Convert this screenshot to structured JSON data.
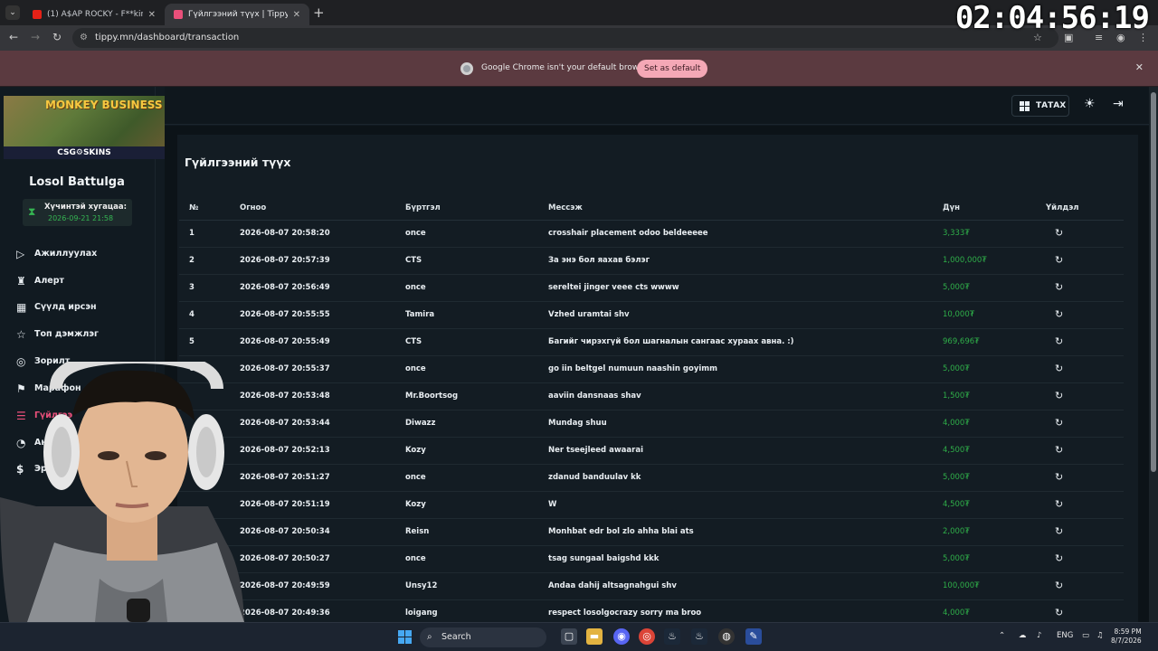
{
  "browser": {
    "tabs": [
      {
        "title": "(1) A$AP ROCKY - F**kin' Probl...",
        "active": false
      },
      {
        "title": "Гүйлгээний түүх | Tippy.mn",
        "active": true
      }
    ],
    "url": "tippy.mn/dashboard/transaction",
    "infobar_text": "Google Chrome isn't your default browser",
    "infobar_button": "Set as default"
  },
  "overlay_clock": "02:04:56:19",
  "header": {
    "download_label": "ТАТАХ"
  },
  "sidebar": {
    "banner_title": "MONKEY BUSINESS",
    "banner_brand": "CSG⚙SKINS",
    "username": "Losol Battulga",
    "subscription_label": "Хүчинтэй хугацаа:",
    "subscription_date": "2026-09-21 21:58",
    "items": [
      {
        "label": "Ажиллуулах",
        "icon": "▷"
      },
      {
        "label": "Алерт",
        "icon": "♜"
      },
      {
        "label": "Сүүлд ирсэн",
        "icon": "▦"
      },
      {
        "label": "Топ дэмжлэг",
        "icon": "☆"
      },
      {
        "label": "Зорилт",
        "icon": "◎"
      },
      {
        "label": "Марафон",
        "icon": "⚑"
      },
      {
        "label": "Гүйлгээ",
        "icon": "☰",
        "active": true
      },
      {
        "label": "Анали",
        "icon": "◔"
      },
      {
        "label": "Эрх",
        "icon": "$"
      }
    ]
  },
  "page": {
    "title": "Гүйлгээний түүх",
    "columns": [
      "№",
      "Огноо",
      "Бүртгэл",
      "Мессэж",
      "Дүн",
      "Үйлдэл"
    ]
  },
  "transactions": [
    {
      "n": "1",
      "date": "2026-08-07 20:58:20",
      "user": "once",
      "msg": "crosshair placement odoo beldeeeee",
      "amt": "3,333₮"
    },
    {
      "n": "2",
      "date": "2026-08-07 20:57:39",
      "user": "CTS",
      "msg": "За энэ бол яахав бэлэг",
      "amt": "1,000,000₮"
    },
    {
      "n": "3",
      "date": "2026-08-07 20:56:49",
      "user": "once",
      "msg": "sereltei jinger veee cts wwww",
      "amt": "5,000₮"
    },
    {
      "n": "4",
      "date": "2026-08-07 20:55:55",
      "user": "Tamira",
      "msg": "Vzhed uramtai shv",
      "amt": "10,000₮"
    },
    {
      "n": "5",
      "date": "2026-08-07 20:55:49",
      "user": "CTS",
      "msg": "Багийг чирэхгүй бол шагналын сангаас хураах авна. :)",
      "amt": "969,696₮"
    },
    {
      "n": "6",
      "date": "2026-08-07 20:55:37",
      "user": "once",
      "msg": "go iin beltgel numuun naashin goyimm",
      "amt": "5,000₮"
    },
    {
      "n": "",
      "date": "2026-08-07 20:53:48",
      "user": "Mr.Boortsog",
      "msg": "aaviin dansnaas shav",
      "amt": "1,500₮"
    },
    {
      "n": "",
      "date": "2026-08-07 20:53:44",
      "user": "Diwazz",
      "msg": "Mundag shuu",
      "amt": "4,000₮"
    },
    {
      "n": "",
      "date": "2026-08-07 20:52:13",
      "user": "Kozy",
      "msg": "Ner tseejleed awaarai",
      "amt": "4,500₮"
    },
    {
      "n": "",
      "date": "2026-08-07 20:51:27",
      "user": "once",
      "msg": "zdanud banduulav kk",
      "amt": "5,000₮"
    },
    {
      "n": "",
      "date": "2026-08-07 20:51:19",
      "user": "Kozy",
      "msg": "W",
      "amt": "4,500₮"
    },
    {
      "n": "",
      "date": "2026-08-07 20:50:34",
      "user": "Reisn",
      "msg": "Monhbat edr bol zlo ahha blai ats",
      "amt": "2,000₮"
    },
    {
      "n": "",
      "date": "2026-08-07 20:50:27",
      "user": "once",
      "msg": "tsag sungaal baigshd kkk",
      "amt": "5,000₮"
    },
    {
      "n": "",
      "date": "2026-08-07 20:49:59",
      "user": "Unsy12",
      "msg": "Andaa dahij altsagnahgui shv",
      "amt": "100,000₮"
    },
    {
      "n": "",
      "date": "2026-08-07 20:49:36",
      "user": "loigang",
      "msg": "respect losolgocrazy sorry ma broo",
      "amt": "4,000₮"
    }
  ],
  "taskbar": {
    "search_placeholder": "Search",
    "lang": "ENG",
    "time": "8:59 PM",
    "date": "8/7/2026"
  },
  "colors": {
    "accent": "#e94f7a",
    "amount": "#2fae49",
    "bg": "#111a21"
  }
}
